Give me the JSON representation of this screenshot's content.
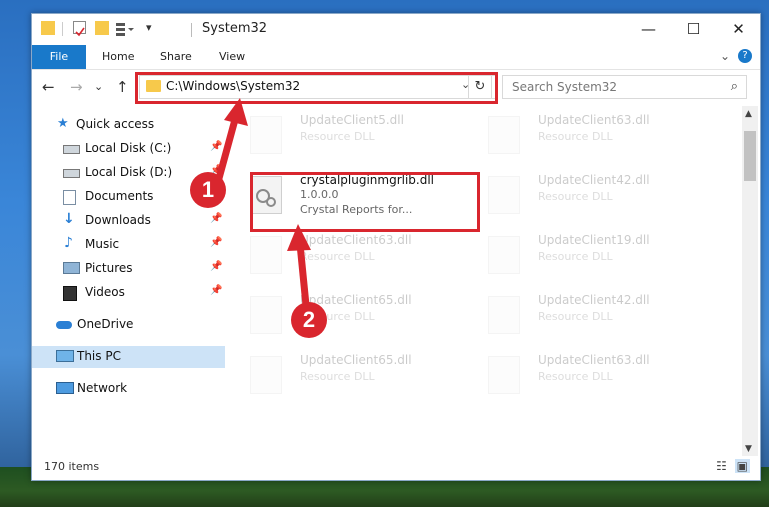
{
  "window": {
    "title": "System32",
    "controls": {
      "minimize": "—",
      "maximize": "☐",
      "close": "✕"
    }
  },
  "ribbon": {
    "tabs": [
      "File",
      "Home",
      "Share",
      "View"
    ],
    "right_controls": {
      "expand": "⌄",
      "help": "?"
    }
  },
  "navbar": {
    "back": "←",
    "forward": "→",
    "recent": "⌄",
    "up": "↑",
    "address": "C:\\Windows\\System32",
    "address_dropdown": "⌄",
    "refresh": "↻",
    "search_placeholder": "Search System32",
    "search_icon": "⌕"
  },
  "sidebar": {
    "items": [
      {
        "label": "Quick access",
        "icon": "star-icon",
        "pinned": false
      },
      {
        "label": "Local Disk (C:)",
        "icon": "drive-icon",
        "pinned": true
      },
      {
        "label": "Local Disk (D:)",
        "icon": "drive-icon",
        "pinned": true
      },
      {
        "label": "Documents",
        "icon": "documents-icon",
        "pinned": true
      },
      {
        "label": "Downloads",
        "icon": "download-icon",
        "pinned": true
      },
      {
        "label": "Music",
        "icon": "music-icon",
        "pinned": true
      },
      {
        "label": "Pictures",
        "icon": "pictures-icon",
        "pinned": true
      },
      {
        "label": "Videos",
        "icon": "videos-icon",
        "pinned": true
      },
      {
        "label": "OneDrive",
        "icon": "cloud-icon",
        "pinned": false
      },
      {
        "label": "This PC",
        "icon": "computer-icon",
        "pinned": false,
        "selected": true
      },
      {
        "label": "Network",
        "icon": "network-icon",
        "pinned": false
      }
    ],
    "pin_glyph": "📌"
  },
  "files": {
    "left_column": [
      {
        "name": "UpdateClient5.dll",
        "type": "Resource DLL",
        "faded": true
      },
      {
        "name": "crystalpluginmgrlib.dll",
        "version": "1.0.0.0",
        "type": "Crystal Reports for...",
        "faded": false
      },
      {
        "name": "UpdateClient63.dll",
        "type": "Resource DLL",
        "faded": true
      },
      {
        "name": "UpdateClient65.dll",
        "type": "Resource DLL",
        "faded": true
      },
      {
        "name": "UpdateClient65.dll",
        "type": "Resource DLL",
        "faded": true
      }
    ],
    "right_column": [
      {
        "name": "UpdateClient63.dll",
        "type": "Resource DLL",
        "faded": true
      },
      {
        "name": "UpdateClient42.dll",
        "type": "Resource DLL",
        "faded": true
      },
      {
        "name": "UpdateClient19.dll",
        "type": "Resource DLL",
        "faded": true
      },
      {
        "name": "UpdateClient42.dll",
        "type": "Resource DLL",
        "faded": true
      },
      {
        "name": "UpdateClient63.dll",
        "type": "Resource DLL",
        "faded": true
      }
    ]
  },
  "status": {
    "item_count": "170 items"
  },
  "callouts": {
    "step1": "1",
    "step2": "2"
  },
  "colors": {
    "accent": "#1979ca",
    "highlight": "#d9262e",
    "selected_bg": "#cde3f7"
  }
}
